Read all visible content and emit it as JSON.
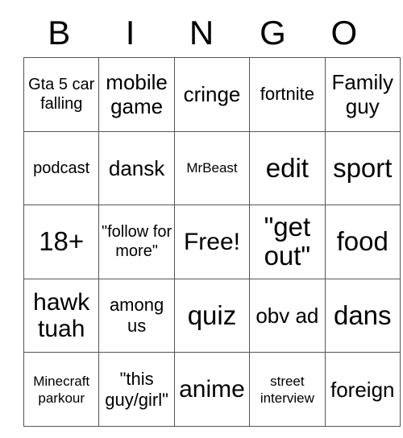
{
  "card": {
    "header_letters": [
      "B",
      "I",
      "N",
      "G",
      "O"
    ],
    "rows": [
      [
        {
          "text": "Gta 5 car falling",
          "size": "fs-xs"
        },
        {
          "text": "mobile game",
          "size": "fs-md"
        },
        {
          "text": "cringe",
          "size": "fs-md"
        },
        {
          "text": "fortnite",
          "size": "fs-sm"
        },
        {
          "text": "Family guy",
          "size": "fs-md"
        }
      ],
      [
        {
          "text": "podcast",
          "size": "fs-xs"
        },
        {
          "text": "dansk",
          "size": "fs-md"
        },
        {
          "text": "MrBeast",
          "size": "fs-xxs"
        },
        {
          "text": "edit",
          "size": "fs-xl"
        },
        {
          "text": "sport",
          "size": "fs-xl"
        }
      ],
      [
        {
          "text": "18+",
          "size": "fs-xl"
        },
        {
          "text": "\"follow for more\"",
          "size": "fs-xs"
        },
        {
          "text": "Free!",
          "size": "fs-lg"
        },
        {
          "text": "\"get out\"",
          "size": "fs-xl"
        },
        {
          "text": "food",
          "size": "fs-xl"
        }
      ],
      [
        {
          "text": "hawk tuah",
          "size": "fs-lg"
        },
        {
          "text": "among us",
          "size": "fs-sm"
        },
        {
          "text": "quiz",
          "size": "fs-xl"
        },
        {
          "text": "obv ad",
          "size": "fs-md"
        },
        {
          "text": "dans",
          "size": "fs-xl"
        }
      ],
      [
        {
          "text": "Minecraft parkour",
          "size": "fs-xxs"
        },
        {
          "text": "\"this guy/girl\"",
          "size": "fs-sm"
        },
        {
          "text": "anime",
          "size": "fs-lg"
        },
        {
          "text": "street interview",
          "size": "fs-xxs"
        },
        {
          "text": "foreign",
          "size": "fs-md"
        }
      ]
    ]
  },
  "colors": {
    "background": "#ffffff",
    "text": "#000000",
    "grid_line": "#555555"
  }
}
